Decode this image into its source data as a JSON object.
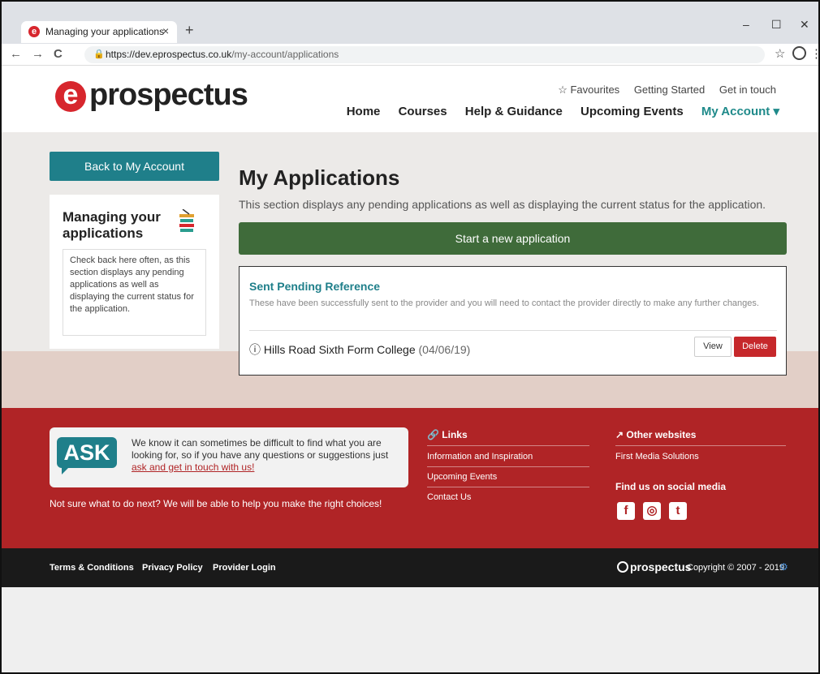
{
  "browser": {
    "tab_title": "Managing your applications",
    "tab_close": "×",
    "new_tab": "+",
    "win_min": "–",
    "win_max": "☐",
    "win_close": "✕",
    "back": "←",
    "forward": "→",
    "reload": "C",
    "url_host": "https://dev.eprospectus.co.uk",
    "url_path": "/my-account/applications",
    "star": "☆",
    "menu": "⋮"
  },
  "header": {
    "logo_mark": "e",
    "logo_word": "prospectus",
    "top_links": [
      "☆ Favourites",
      "Getting Started",
      "Get in touch"
    ],
    "nav": [
      "Home",
      "Courses",
      "Help & Guidance",
      "Upcoming Events"
    ],
    "nav_active": "My Account ▾"
  },
  "sidebar": {
    "back_button": "Back to My Account",
    "card_title": "Managing your applications",
    "card_note": "Check back here often, as this section displays any pending applications as well as displaying the current status for the application."
  },
  "main": {
    "title": "My Applications",
    "description": "This section displays any pending applications as well as displaying the current status for the application.",
    "start_button": "Start a new application",
    "card": {
      "heading": "Sent Pending Reference",
      "desc": "These have been successfully sent to the provider and you will need to contact the provider directly to make any further changes.",
      "item_icon": "ⓘ",
      "item_name": "Hills Road Sixth Form College",
      "item_date": "(04/06/19)",
      "view": "View",
      "delete": "Delete"
    }
  },
  "footer": {
    "ask_badge": "ASK",
    "ask_text": "We know it can sometimes be difficult to find what you are looking for, so if you have any questions or suggestions just",
    "ask_link": "ask and get in touch with us!",
    "not_sure": "Not sure what to do next? We will be able to help you make the right choices!",
    "links_heading": "🔗 Links",
    "links": [
      "Information and Inspiration",
      "Upcoming Events",
      "Contact Us"
    ],
    "other_heading": "↗ Other websites",
    "other_links": [
      "First Media Solutions"
    ],
    "social_heading": "Find us on social media",
    "social": [
      "f",
      "◎",
      "t"
    ]
  },
  "bottom": {
    "links": [
      "Terms & Conditions",
      "Privacy Policy",
      "Provider Login"
    ],
    "logo": "prospectus",
    "copyright": "Copyright © 2007 - 2019",
    "gear": "⚙"
  }
}
